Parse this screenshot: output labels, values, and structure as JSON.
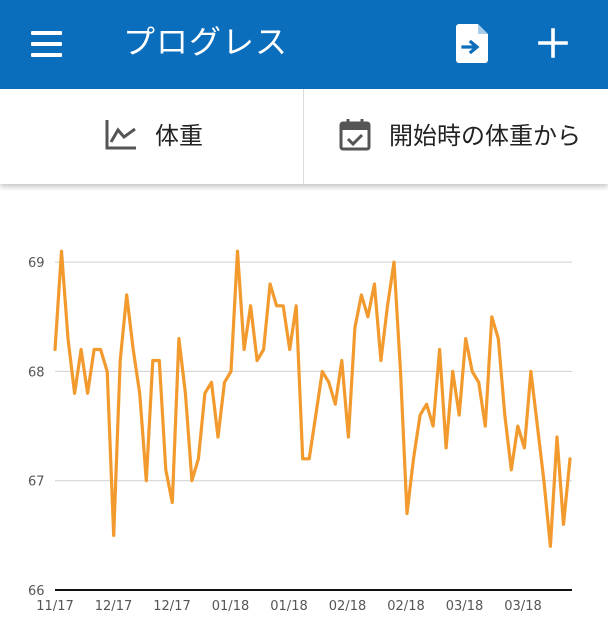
{
  "app_bar": {
    "title": "プログレス",
    "color": "#0a6ebd",
    "menu_icon": "menu-icon",
    "export_icon": "file-export-icon",
    "add_icon": "plus-icon"
  },
  "tabs": [
    {
      "label": "体重",
      "icon": "line-chart-icon"
    },
    {
      "label": "開始時の体重から",
      "icon": "calendar-check-icon"
    }
  ],
  "chart_data": {
    "type": "line",
    "title": "",
    "xlabel": "",
    "ylabel": "",
    "ylim": [
      66,
      69.2
    ],
    "y_ticks": [
      "69",
      "68",
      "67",
      "66"
    ],
    "x_tick_labels": [
      "11/17",
      "12/17",
      "12/17",
      "01/18",
      "01/18",
      "02/18",
      "02/18",
      "03/18",
      "03/18"
    ],
    "line_color": "#f29a2e",
    "grid": true,
    "series": [
      {
        "values": [
          68.2,
          69.1,
          68.3,
          67.8,
          68.2,
          67.8,
          68.2,
          68.2,
          68.0,
          66.5,
          68.1,
          68.7,
          68.2,
          67.8,
          67.0,
          68.1,
          68.1,
          67.1,
          66.8,
          68.3,
          67.8,
          67.0,
          67.2,
          67.8,
          67.9,
          67.4,
          67.9,
          68.0,
          69.1,
          68.2,
          68.6,
          68.1,
          68.2,
          68.8,
          68.6,
          68.6,
          68.2,
          68.6,
          67.2,
          67.2,
          67.6,
          68.0,
          67.9,
          67.7,
          68.1,
          67.4,
          68.4,
          68.7,
          68.5,
          68.8,
          68.1,
          68.6,
          69.0,
          68.0,
          66.7,
          67.2,
          67.6,
          67.7,
          67.5,
          68.2,
          67.3,
          68.0,
          67.6,
          68.3,
          68.0,
          67.9,
          67.5,
          68.5,
          68.3,
          67.6,
          67.1,
          67.5,
          67.3,
          68.0,
          67.5,
          67.0,
          66.4,
          67.4,
          66.6,
          67.2
        ]
      }
    ]
  }
}
